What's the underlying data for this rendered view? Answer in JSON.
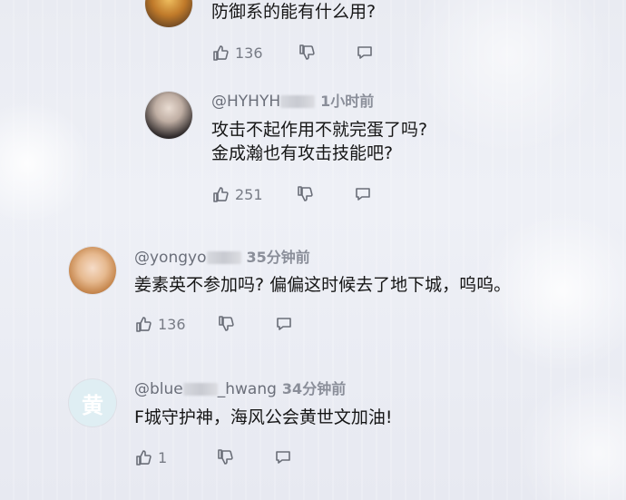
{
  "comments": [
    {
      "text_lines": [
        "防御系的能有什么用?"
      ],
      "likes": "136"
    },
    {
      "username_visible_start": "@HYHYH",
      "time": "1小时前",
      "text_lines": [
        "攻击不起作用不就完蛋了吗?",
        "金成瀚也有攻击技能吧?"
      ],
      "likes": "251"
    },
    {
      "username_visible_start": "@yongyo",
      "time": "35分钟前",
      "text_lines": [
        "姜素英不参加吗? 偏偏这时候去了地下城，呜呜。"
      ],
      "likes": "136"
    },
    {
      "avatar_char": "黄",
      "username_visible_start": "@blue",
      "username_visible_end": "_hwang",
      "time": "34分钟前",
      "text_lines": [
        "F城守护神，海风公会黄世文加油!"
      ],
      "likes": "1"
    }
  ],
  "icons": {
    "like": "thumbs-up-icon",
    "dislike": "thumbs-down-icon",
    "reply": "reply-icon"
  },
  "colors": {
    "avatar_bg_huang": "#dfeef3",
    "avatar_char_color": "#ffffff",
    "meta_text": "#6b6f7a"
  }
}
